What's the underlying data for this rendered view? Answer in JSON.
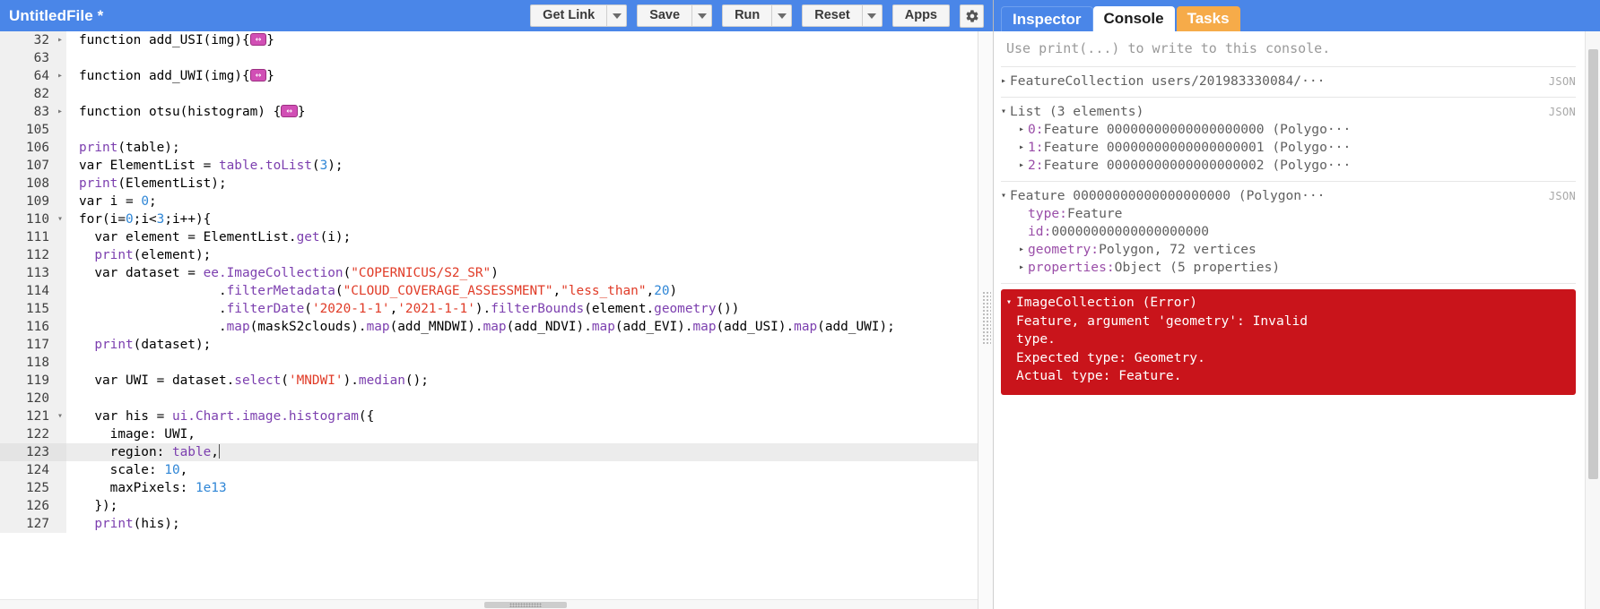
{
  "editor": {
    "file_title": "UntitledFile *",
    "toolbar": {
      "get_link_label": "Get Link",
      "save_label": "Save",
      "run_label": "Run",
      "reset_label": "Reset",
      "apps_label": "Apps",
      "settings_icon": "gear-icon",
      "dropdown_icon": "chevron-down-icon"
    },
    "folded_placeholder": "↔",
    "lines": [
      {
        "num": "32",
        "fold": "▸",
        "active": false,
        "tokens": [
          {
            "t": "function ",
            "c": "kw"
          },
          {
            "t": "add_USI",
            "c": "plain"
          },
          {
            "t": "(img){",
            "c": "plain"
          },
          {
            "t": "FOLD",
            "c": "fold"
          },
          {
            "t": "}",
            "c": "plain"
          }
        ]
      },
      {
        "num": "63",
        "fold": "",
        "active": false,
        "tokens": []
      },
      {
        "num": "64",
        "fold": "▸",
        "active": false,
        "tokens": [
          {
            "t": "function ",
            "c": "kw"
          },
          {
            "t": "add_UWI",
            "c": "plain"
          },
          {
            "t": "(img){",
            "c": "plain"
          },
          {
            "t": "FOLD",
            "c": "fold"
          },
          {
            "t": "}",
            "c": "plain"
          }
        ]
      },
      {
        "num": "82",
        "fold": "",
        "active": false,
        "tokens": []
      },
      {
        "num": "83",
        "fold": "▸",
        "active": false,
        "tokens": [
          {
            "t": "function ",
            "c": "kw"
          },
          {
            "t": "otsu",
            "c": "plain"
          },
          {
            "t": "(histogram) {",
            "c": "plain"
          },
          {
            "t": "FOLD",
            "c": "fold"
          },
          {
            "t": "}",
            "c": "plain"
          }
        ]
      },
      {
        "num": "105",
        "fold": "",
        "active": false,
        "tokens": []
      },
      {
        "num": "106",
        "fold": "",
        "active": false,
        "tokens": [
          {
            "t": "print",
            "c": "fn"
          },
          {
            "t": "(table);",
            "c": "plain"
          }
        ]
      },
      {
        "num": "107",
        "fold": "",
        "active": false,
        "tokens": [
          {
            "t": "var ElementList = ",
            "c": "plain"
          },
          {
            "t": "table.toList",
            "c": "fn"
          },
          {
            "t": "(",
            "c": "plain"
          },
          {
            "t": "3",
            "c": "num"
          },
          {
            "t": ");",
            "c": "plain"
          }
        ]
      },
      {
        "num": "108",
        "fold": "",
        "active": false,
        "tokens": [
          {
            "t": "print",
            "c": "fn"
          },
          {
            "t": "(ElementList);",
            "c": "plain"
          }
        ]
      },
      {
        "num": "109",
        "fold": "",
        "active": false,
        "tokens": [
          {
            "t": "var i = ",
            "c": "plain"
          },
          {
            "t": "0",
            "c": "num"
          },
          {
            "t": ";",
            "c": "plain"
          }
        ]
      },
      {
        "num": "110",
        "fold": "▾",
        "active": false,
        "tokens": [
          {
            "t": "for(i=",
            "c": "plain"
          },
          {
            "t": "0",
            "c": "num"
          },
          {
            "t": ";i<",
            "c": "plain"
          },
          {
            "t": "3",
            "c": "num"
          },
          {
            "t": ";i++){",
            "c": "plain"
          }
        ]
      },
      {
        "num": "111",
        "fold": "",
        "active": false,
        "tokens": [
          {
            "t": "  var element = ElementList.",
            "c": "plain"
          },
          {
            "t": "get",
            "c": "fn"
          },
          {
            "t": "(i);",
            "c": "plain"
          }
        ]
      },
      {
        "num": "112",
        "fold": "",
        "active": false,
        "tokens": [
          {
            "t": "  ",
            "c": "plain"
          },
          {
            "t": "print",
            "c": "fn"
          },
          {
            "t": "(element);",
            "c": "plain"
          }
        ]
      },
      {
        "num": "113",
        "fold": "",
        "active": false,
        "tokens": [
          {
            "t": "  var dataset = ",
            "c": "plain"
          },
          {
            "t": "ee.ImageCollection",
            "c": "fn"
          },
          {
            "t": "(",
            "c": "plain"
          },
          {
            "t": "\"COPERNICUS/S2_SR\"",
            "c": "str"
          },
          {
            "t": ")",
            "c": "plain"
          }
        ]
      },
      {
        "num": "114",
        "fold": "",
        "active": false,
        "tokens": [
          {
            "t": "                  .",
            "c": "plain"
          },
          {
            "t": "filterMetadata",
            "c": "fn"
          },
          {
            "t": "(",
            "c": "plain"
          },
          {
            "t": "\"CLOUD_COVERAGE_ASSESSMENT\"",
            "c": "str"
          },
          {
            "t": ",",
            "c": "plain"
          },
          {
            "t": "\"less_than\"",
            "c": "str"
          },
          {
            "t": ",",
            "c": "plain"
          },
          {
            "t": "20",
            "c": "num"
          },
          {
            "t": ")",
            "c": "plain"
          }
        ]
      },
      {
        "num": "115",
        "fold": "",
        "active": false,
        "tokens": [
          {
            "t": "                  .",
            "c": "plain"
          },
          {
            "t": "filterDate",
            "c": "fn"
          },
          {
            "t": "(",
            "c": "plain"
          },
          {
            "t": "'2020-1-1'",
            "c": "str"
          },
          {
            "t": ",",
            "c": "plain"
          },
          {
            "t": "'2021-1-1'",
            "c": "str"
          },
          {
            "t": ").",
            "c": "plain"
          },
          {
            "t": "filterBounds",
            "c": "fn"
          },
          {
            "t": "(element.",
            "c": "plain"
          },
          {
            "t": "geometry",
            "c": "fn"
          },
          {
            "t": "())",
            "c": "plain"
          }
        ]
      },
      {
        "num": "116",
        "fold": "",
        "active": false,
        "tokens": [
          {
            "t": "                  .",
            "c": "plain"
          },
          {
            "t": "map",
            "c": "fn"
          },
          {
            "t": "(maskS2clouds).",
            "c": "plain"
          },
          {
            "t": "map",
            "c": "fn"
          },
          {
            "t": "(add_MNDWI).",
            "c": "plain"
          },
          {
            "t": "map",
            "c": "fn"
          },
          {
            "t": "(add_NDVI).",
            "c": "plain"
          },
          {
            "t": "map",
            "c": "fn"
          },
          {
            "t": "(add_EVI).",
            "c": "plain"
          },
          {
            "t": "map",
            "c": "fn"
          },
          {
            "t": "(add_USI).",
            "c": "plain"
          },
          {
            "t": "map",
            "c": "fn"
          },
          {
            "t": "(add_UWI);",
            "c": "plain"
          }
        ]
      },
      {
        "num": "117",
        "fold": "",
        "active": false,
        "tokens": [
          {
            "t": "  ",
            "c": "plain"
          },
          {
            "t": "print",
            "c": "fn"
          },
          {
            "t": "(dataset);",
            "c": "plain"
          }
        ]
      },
      {
        "num": "118",
        "fold": "",
        "active": false,
        "tokens": []
      },
      {
        "num": "119",
        "fold": "",
        "active": false,
        "tokens": [
          {
            "t": "  var UWI = dataset.",
            "c": "plain"
          },
          {
            "t": "select",
            "c": "fn"
          },
          {
            "t": "(",
            "c": "plain"
          },
          {
            "t": "'MNDWI'",
            "c": "str"
          },
          {
            "t": ").",
            "c": "plain"
          },
          {
            "t": "median",
            "c": "fn"
          },
          {
            "t": "();",
            "c": "plain"
          }
        ]
      },
      {
        "num": "120",
        "fold": "",
        "active": false,
        "tokens": []
      },
      {
        "num": "121",
        "fold": "▾",
        "active": false,
        "tokens": [
          {
            "t": "  var his = ",
            "c": "plain"
          },
          {
            "t": "ui.Chart.image.histogram",
            "c": "fn"
          },
          {
            "t": "({",
            "c": "plain"
          }
        ]
      },
      {
        "num": "122",
        "fold": "",
        "active": false,
        "tokens": [
          {
            "t": "    image: UWI,",
            "c": "plain"
          }
        ]
      },
      {
        "num": "123",
        "fold": "",
        "active": true,
        "tokens": [
          {
            "t": "    region: ",
            "c": "plain"
          },
          {
            "t": "table",
            "c": "fn"
          },
          {
            "t": ",",
            "c": "plain"
          },
          {
            "t": "CURSOR",
            "c": "cursor"
          }
        ]
      },
      {
        "num": "124",
        "fold": "",
        "active": false,
        "tokens": [
          {
            "t": "    scale: ",
            "c": "plain"
          },
          {
            "t": "10",
            "c": "num"
          },
          {
            "t": ",",
            "c": "plain"
          }
        ]
      },
      {
        "num": "125",
        "fold": "",
        "active": false,
        "tokens": [
          {
            "t": "    maxPixels: ",
            "c": "plain"
          },
          {
            "t": "1e13",
            "c": "num"
          }
        ]
      },
      {
        "num": "126",
        "fold": "",
        "active": false,
        "tokens": [
          {
            "t": "  });",
            "c": "plain"
          }
        ]
      },
      {
        "num": "127",
        "fold": "",
        "active": false,
        "tokens": [
          {
            "t": "  ",
            "c": "plain"
          },
          {
            "t": "print",
            "c": "fn"
          },
          {
            "t": "(his);",
            "c": "plain"
          }
        ]
      }
    ]
  },
  "console": {
    "tabs": [
      {
        "label": "Inspector",
        "state": "inactive"
      },
      {
        "label": "Console",
        "state": "active"
      },
      {
        "label": "Tasks",
        "state": "tasks"
      }
    ],
    "hint": "Use print(...) to write to this console.",
    "json_label": "JSON",
    "twisty_closed": "▸",
    "twisty_open": "▾",
    "entries": [
      {
        "id": "featurecollection",
        "twisty": "▸",
        "text": "FeatureCollection users/201983330084/···",
        "json": "JSON",
        "children": []
      },
      {
        "id": "list",
        "twisty": "▾",
        "text": "List (3 elements)",
        "json": "JSON",
        "children": [
          {
            "twisty": "▸",
            "key": "0:",
            "value": " Feature 00000000000000000000 (Polygo···"
          },
          {
            "twisty": "▸",
            "key": "1:",
            "value": " Feature 00000000000000000001 (Polygo···"
          },
          {
            "twisty": "▸",
            "key": "2:",
            "value": " Feature 00000000000000000002 (Polygo···"
          }
        ]
      },
      {
        "id": "feature",
        "twisty": "▾",
        "text": "Feature 00000000000000000000 (Polygon···",
        "json": "JSON",
        "children": [
          {
            "twisty": "",
            "key": "type:",
            "value": " Feature"
          },
          {
            "twisty": "",
            "key": "id:",
            "value": " 00000000000000000000"
          },
          {
            "twisty": "▸",
            "key": "geometry:",
            "value": " Polygon, 72 vertices"
          },
          {
            "twisty": "▸",
            "key": "properties:",
            "value": " Object (5 properties)"
          }
        ]
      }
    ],
    "error": {
      "twisty": "▾",
      "title": "ImageCollection (Error)",
      "lines": [
        "Feature, argument 'geometry': Invalid",
        "type.",
        "Expected type: Geometry.",
        "Actual type: Feature."
      ],
      "background_color": "#c9141b",
      "text_color": "#ffffff"
    }
  },
  "theme": {
    "toolbar_blue": "#4a86e8",
    "tasks_orange": "#f6ab49",
    "fold_magenta": "#d14fb5",
    "string_red": "#e03b27",
    "function_purple": "#7c3faf",
    "number_blue": "#2f86d6",
    "console_key_purple": "#9a4ea8"
  }
}
